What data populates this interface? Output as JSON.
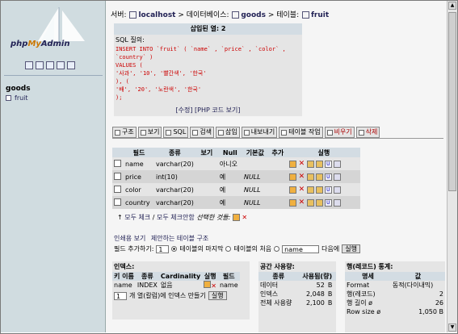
{
  "left": {
    "logo": {
      "php": "php",
      "my": "My",
      "admin": "Admin"
    },
    "database": "goods",
    "table": "fruit"
  },
  "breadcrumb": {
    "server_label": "서버:",
    "server": "localhost",
    "db_label": "데이터베이스:",
    "db": "goods",
    "table_label": "테이블:",
    "table": "fruit"
  },
  "message": {
    "header": "삽입된 열: 2",
    "sql_label": "SQL 질의:",
    "sql_lines": [
      "INSERT INTO `fruit` ( `name` , `price` , `color` , `country` )",
      "VALUES (",
      "  '사과', '10', '빨간색', '한국'",
      "), (",
      "  '배', '20', '노란색', '한국'",
      ");"
    ],
    "edit_link": "[수정]",
    "php_link": "[PHP 코드 보기]"
  },
  "tabs": [
    "구조",
    "보기",
    "SQL",
    "검색",
    "삽입",
    "내보내기",
    "테이블 작업",
    "비우기",
    "삭제"
  ],
  "structure": {
    "headers": [
      "필드",
      "종류",
      "보기",
      "Null",
      "기본값",
      "추가",
      "실행"
    ],
    "rows": [
      {
        "field": "name",
        "type": "varchar(20)",
        "null": "아니오",
        "default": ""
      },
      {
        "field": "price",
        "type": "int(10)",
        "null": "예",
        "default": "NULL"
      },
      {
        "field": "color",
        "type": "varchar(20)",
        "null": "예",
        "default": "NULL"
      },
      {
        "field": "country",
        "type": "varchar(20)",
        "null": "예",
        "default": "NULL"
      }
    ]
  },
  "selection": {
    "check_all": "모두 체크",
    "slash": "/",
    "uncheck_all": "모두 체크안함",
    "selected": "선택한 것들:"
  },
  "actions": {
    "print_view": "인쇄용 보기",
    "propose": "제안하는 테이블 구조",
    "add_field": "필드 추가하기:",
    "add_count": "1",
    "at_end": "테이블의 마지막",
    "at_begin": "테이블의 처음",
    "after_col": "name",
    "after_label": "다음에",
    "go": "실행"
  },
  "indexes": {
    "title": "인덱스:",
    "headers": [
      "키 이름",
      "종류",
      "Cardinality",
      "실행",
      "필드"
    ],
    "row": {
      "key": "name",
      "type": "INDEX",
      "card": "없음",
      "field": "name"
    },
    "create_count": "1",
    "create_label": "개 열(칼럼)에 인덱스 만들기",
    "create_btn": "실행"
  },
  "space": {
    "title": "공간 사용량:",
    "headers": [
      "종류",
      "사용됨(량)"
    ],
    "rows": [
      {
        "type": "데이터",
        "value": "52",
        "unit": "B"
      },
      {
        "type": "인덱스",
        "value": "2,048",
        "unit": "B"
      },
      {
        "type": "전체 사용량",
        "value": "2,100",
        "unit": "B"
      }
    ]
  },
  "stats": {
    "title": "행(레코드) 통계:",
    "headers": [
      "명세",
      "값"
    ],
    "rows": [
      {
        "k": "Format",
        "v": "동적(다이내믹)"
      },
      {
        "k": "행(레코드)",
        "v": "2"
      },
      {
        "k": "행 길이 ø",
        "v": "26"
      },
      {
        "k": "Row size ø",
        "v": "1,050 B"
      }
    ]
  }
}
